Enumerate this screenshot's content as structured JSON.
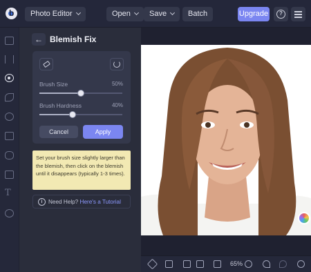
{
  "topbar": {
    "app_label": "Photo Editor",
    "open_label": "Open",
    "save_label": "Save",
    "batch_label": "Batch",
    "upgrade_label": "Upgrade",
    "help_glyph": "?"
  },
  "rail": {
    "items": [
      {
        "icon": "image-icon",
        "active": false
      },
      {
        "icon": "sliders-icon",
        "active": false
      },
      {
        "icon": "eye-icon",
        "active": true
      },
      {
        "icon": "sparkle-icon",
        "active": false
      },
      {
        "icon": "palette-icon",
        "active": false
      },
      {
        "icon": "frame-icon",
        "active": false
      },
      {
        "icon": "shapes-icon",
        "active": false
      },
      {
        "icon": "texture-icon",
        "active": false
      },
      {
        "icon": "text-icon",
        "active": false,
        "glyph": "T"
      },
      {
        "icon": "layers-icon",
        "active": false
      }
    ]
  },
  "panel": {
    "back_glyph": "←",
    "title": "Blemish Fix",
    "brush_size": {
      "label": "Brush Size",
      "value_text": "50%",
      "value": 0.5
    },
    "brush_hardness": {
      "label": "Brush Hardness",
      "value_text": "40%",
      "value": 0.4
    },
    "cancel_label": "Cancel",
    "apply_label": "Apply",
    "tip": "Set your brush size slightly larger than the blemish, then click on the blemish until it disappears (typically 1-3 times).",
    "help_prefix": "Need Help?",
    "help_link": "Here's a Tutorial",
    "info_glyph": "i"
  },
  "canvas": {
    "zoom": "65%"
  },
  "colors": {
    "accent": "#7b86f1",
    "tip_bg": "#f2e9b3",
    "link": "#8d99ff"
  }
}
